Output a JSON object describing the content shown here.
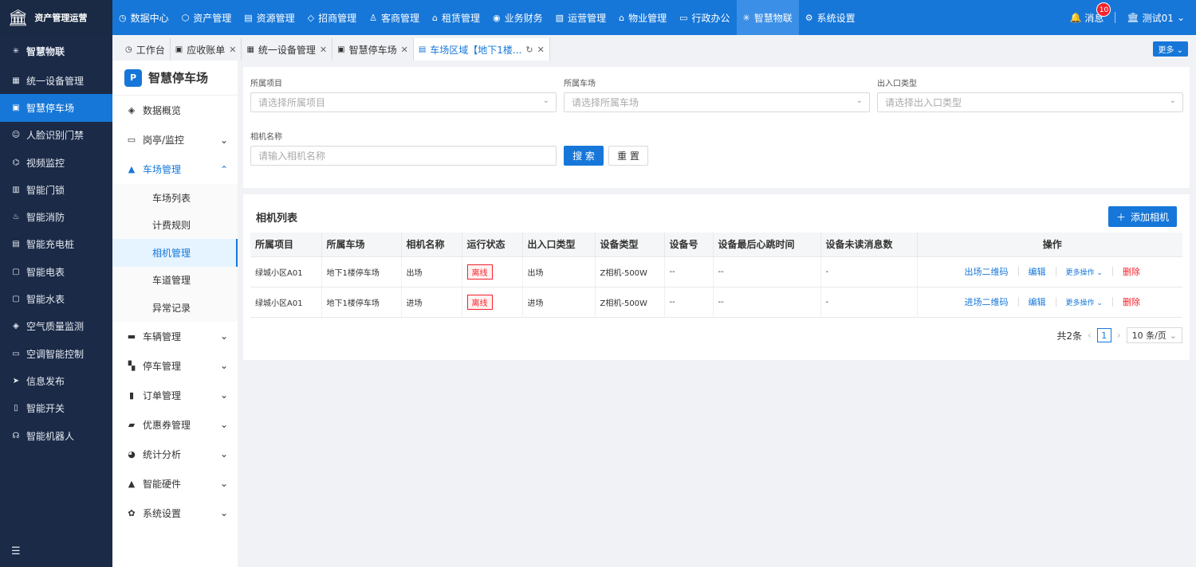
{
  "app": {
    "title": "资产管理运营",
    "accent": "#1677d9"
  },
  "topnav": [
    {
      "label": "数据中心",
      "icon": "◷"
    },
    {
      "label": "资产管理",
      "icon": "⬡"
    },
    {
      "label": "资源管理",
      "icon": "▤"
    },
    {
      "label": "招商管理",
      "icon": "◇"
    },
    {
      "label": "客商管理",
      "icon": "♙"
    },
    {
      "label": "租赁管理",
      "icon": "⌂"
    },
    {
      "label": "业务财务",
      "icon": "◉"
    },
    {
      "label": "运营管理",
      "icon": "▧"
    },
    {
      "label": "物业管理",
      "icon": "⌂"
    },
    {
      "label": "行政办公",
      "icon": "▭"
    },
    {
      "label": "智慧物联",
      "icon": "✳"
    },
    {
      "label": "系统设置",
      "icon": "⚙"
    }
  ],
  "top_right": {
    "message_label": "消息",
    "message_count": "10",
    "user_label": "测试01"
  },
  "leftnav": {
    "header": "智慧物联",
    "items": [
      "统一设备管理",
      "智慧停车场",
      "人脸识别门禁",
      "视频监控",
      "智能门锁",
      "智能消防",
      "智能充电桩",
      "智能电表",
      "智能水表",
      "空气质量监测",
      "空调智能控制",
      "信息发布",
      "智能开关",
      "智能机器人"
    ]
  },
  "tabs": [
    {
      "label": "工作台",
      "icon": "◷",
      "closable": false
    },
    {
      "label": "应收账单",
      "icon": "▣",
      "closable": true
    },
    {
      "label": "统一设备管理",
      "icon": "▦",
      "closable": true
    },
    {
      "label": "智慧停车场",
      "icon": "▣",
      "closable": true
    },
    {
      "label": "车场区域【地下1楼...",
      "icon": "▤",
      "closable": true
    }
  ],
  "tabs_more_label": "更多",
  "subnav": {
    "title": "智慧停车场",
    "groups": [
      {
        "label": "数据概览",
        "icon": "◈"
      },
      {
        "label": "岗亭/监控",
        "icon": "▭"
      },
      {
        "label": "车场管理",
        "icon": "▲"
      }
    ],
    "sub_items": [
      "车场列表",
      "计费规则",
      "相机管理",
      "车道管理",
      "异常记录"
    ],
    "groups_after": [
      {
        "label": "车辆管理",
        "icon": "▬"
      },
      {
        "label": "停车管理",
        "icon": "▚"
      },
      {
        "label": "订单管理",
        "icon": "▮"
      },
      {
        "label": "优惠券管理",
        "icon": "▰"
      },
      {
        "label": "统计分析",
        "icon": "◕"
      },
      {
        "label": "智能硬件",
        "icon": "▲"
      },
      {
        "label": "系统设置",
        "icon": "✿"
      }
    ]
  },
  "filter": {
    "project_label": "所属项目",
    "project_placeholder": "请选择所属项目",
    "lot_label": "所属车场",
    "lot_placeholder": "请选择所属车场",
    "gate_label": "出入口类型",
    "gate_placeholder": "请选择出入口类型",
    "camera_label": "相机名称",
    "camera_placeholder": "请输入相机名称",
    "search_label": "搜 索",
    "reset_label": "重 置"
  },
  "list": {
    "title": "相机列表",
    "add_label": "添加相机",
    "columns": [
      "所属项目",
      "所属车场",
      "相机名称",
      "运行状态",
      "出入口类型",
      "设备类型",
      "设备号",
      "设备最后心跳时间",
      "设备未读消息数",
      "操作"
    ],
    "rows": [
      {
        "project": "绿城小区A01",
        "lot": "地下1楼停车场",
        "name": "出场",
        "status": "离线",
        "gate": "出场",
        "type": "Z相机-500W",
        "device_no": "--",
        "heartbeat": "--",
        "unread": "-",
        "qr": "出场二维码",
        "edit": "编辑",
        "more": "更多操作",
        "delete": "删除"
      },
      {
        "project": "绿城小区A01",
        "lot": "地下1楼停车场",
        "name": "进场",
        "status": "离线",
        "gate": "进场",
        "type": "Z相机-500W",
        "device_no": "--",
        "heartbeat": "--",
        "unread": "-",
        "qr": "进场二维码",
        "edit": "编辑",
        "more": "更多操作",
        "delete": "删除"
      }
    ],
    "total": "共2条",
    "page": "1",
    "page_size": "10 条/页"
  }
}
